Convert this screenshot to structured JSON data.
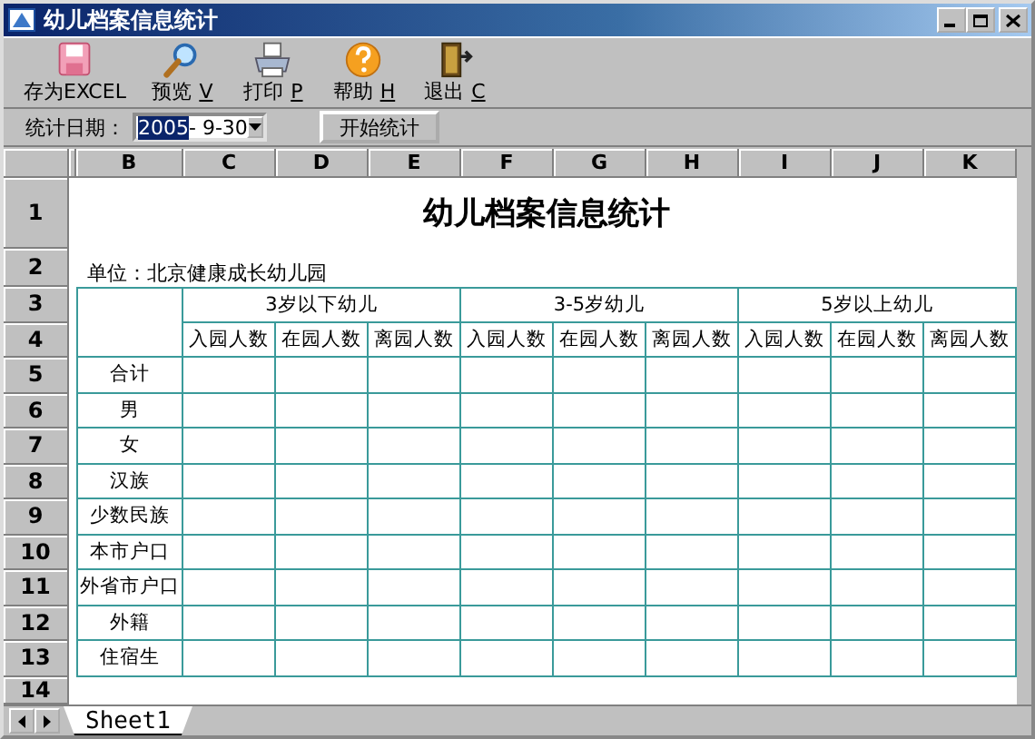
{
  "window": {
    "title": "幼儿档案信息统计"
  },
  "toolbar": [
    {
      "kind": "disk",
      "label": "存为EXCEL"
    },
    {
      "kind": "magnifier",
      "label": "预览",
      "shortcut": "V"
    },
    {
      "kind": "printer",
      "label": "打印",
      "shortcut": "P"
    },
    {
      "kind": "help",
      "label": "帮助",
      "shortcut": "H"
    },
    {
      "kind": "door",
      "label": "退出",
      "shortcut": "C"
    }
  ],
  "date_filter": {
    "label": "统计日期：",
    "value_parts": [
      {
        "text": "2005",
        "selected": true
      },
      {
        "text": "- 9-30",
        "selected": false
      }
    ],
    "button": "开始统计"
  },
  "sheet": {
    "columns": [
      "B",
      "C",
      "D",
      "E",
      "F",
      "G",
      "H",
      "I",
      "J",
      "K"
    ],
    "rows": [
      "1",
      "2",
      "3",
      "4",
      "5",
      "6",
      "7",
      "8",
      "9",
      "10",
      "11",
      "12",
      "13",
      "14"
    ],
    "title": "幼儿档案信息统计",
    "unit": "单位：北京健康成长幼儿园",
    "groups": [
      "3岁以下幼儿",
      "3-5岁幼儿",
      "5岁以上幼儿"
    ],
    "subheaders": [
      "入园人数",
      "在园人数",
      "离园人数",
      "入园人数",
      "在园人数",
      "离园人数",
      "入园人数",
      "在园人数",
      "离园人数"
    ],
    "row_labels": [
      "合计",
      "男",
      "女",
      "汉族",
      "少数民族",
      "本市户口",
      "外省市户口",
      "外籍",
      "住宿生"
    ]
  },
  "tabs": [
    {
      "label": "Sheet1",
      "selected": true
    }
  ]
}
